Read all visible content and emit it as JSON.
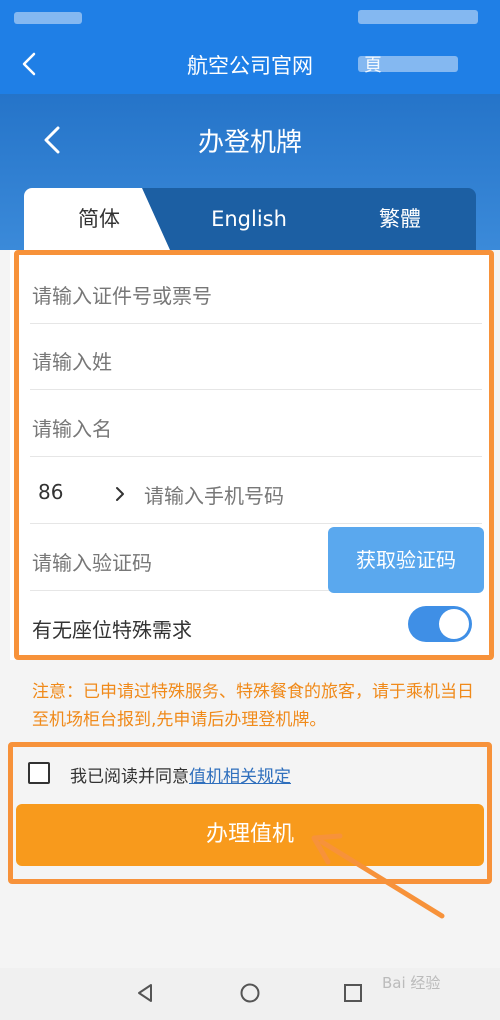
{
  "topbar": {
    "title": "航空公司官网",
    "right_text": "頁"
  },
  "page": {
    "title": "办登机牌"
  },
  "tabs": [
    {
      "label": "简体",
      "active": true
    },
    {
      "label": "English",
      "active": false
    },
    {
      "label": "繁體",
      "active": false
    }
  ],
  "form": {
    "id_placeholder": "请输入证件号或票号",
    "surname_placeholder": "请输入姓",
    "givenname_placeholder": "请输入名",
    "country_code": "86",
    "phone_placeholder": "请输入手机号码",
    "code_placeholder": "请输入验证码",
    "get_code_label": "获取验证码",
    "special_seat_label": "有无座位特殊需求",
    "special_seat_on": true
  },
  "notice": "注意：已申请过特殊服务、特殊餐食的旅客，请于乘机当日至机场柜台报到,先申请后办理登机牌。",
  "agreement": {
    "prefix": "我已阅读并同意",
    "link": "值机相关规定",
    "checked": false
  },
  "submit_label": "办理值机",
  "watermark": "Bai 经验",
  "colors": {
    "primary": "#1f7fe6",
    "accent": "#f89a1c",
    "highlight": "#f7923a",
    "notice": "#f08a1a",
    "link": "#2f6fbd"
  }
}
